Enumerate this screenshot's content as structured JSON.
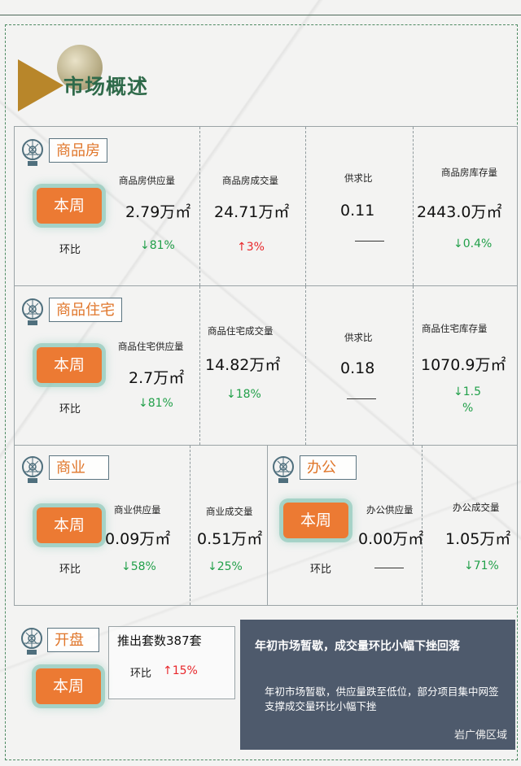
{
  "page_title": "市场概述",
  "colors": {
    "accent": "#ec7a33",
    "frame": "#4e8a63",
    "title": "#2f6a4a",
    "down": "#22a04a",
    "up": "#e8262a",
    "summary_bg": "#4e5a6c"
  },
  "week_label": "本周",
  "huanbi_label": "环比",
  "sections": {
    "commercial_housing": {
      "tag": "商品房",
      "metrics": [
        {
          "label": "商品房供应量",
          "value": "2.79万㎡",
          "change": "↓81%"
        },
        {
          "label": "商品房成交量",
          "value": "24.71万㎡",
          "change": "↑3%"
        },
        {
          "label": "供求比",
          "value": "0.11",
          "change": "——"
        },
        {
          "label": "商品房库存量",
          "value": "2443.0万㎡",
          "change": "↓0.4%"
        }
      ]
    },
    "residential": {
      "tag": "商品住宅",
      "metrics": [
        {
          "label": "商品住宅供应量",
          "value": "2.7万㎡",
          "change": "↓81%"
        },
        {
          "label": "商品住宅成交量",
          "value": "14.82万㎡",
          "change": "↓18%"
        },
        {
          "label": "供求比",
          "value": "0.18",
          "change": "——"
        },
        {
          "label": "商品住宅库存量",
          "value": "1070.9万㎡",
          "change_line1": "↓1.5",
          "change_line2": "%"
        }
      ]
    },
    "business": {
      "tag": "商业",
      "metrics": [
        {
          "label": "商业供应量",
          "value": "0.09万㎡",
          "change": "↓58%"
        },
        {
          "label": "商业成交量",
          "value": "0.51万㎡",
          "change": "↓25%"
        }
      ]
    },
    "office": {
      "tag": "办公",
      "metrics": [
        {
          "label": "办公供应量",
          "value": "0.00万㎡",
          "change": "——"
        },
        {
          "label": "办公成交量",
          "value": "1.05万㎡",
          "change": "↓71%"
        }
      ]
    },
    "opening": {
      "tag": "开盘",
      "launch_text": "推出套数387套",
      "change": "↑15%"
    }
  },
  "summary": {
    "title": "年初市场暂歇，成交量环比小幅下挫回落",
    "body": "年初市场暂歇，供应量跌至低位，部分项目集中网签支撑成交量环比小幅下挫"
  },
  "watermark": "岩广佛区域"
}
